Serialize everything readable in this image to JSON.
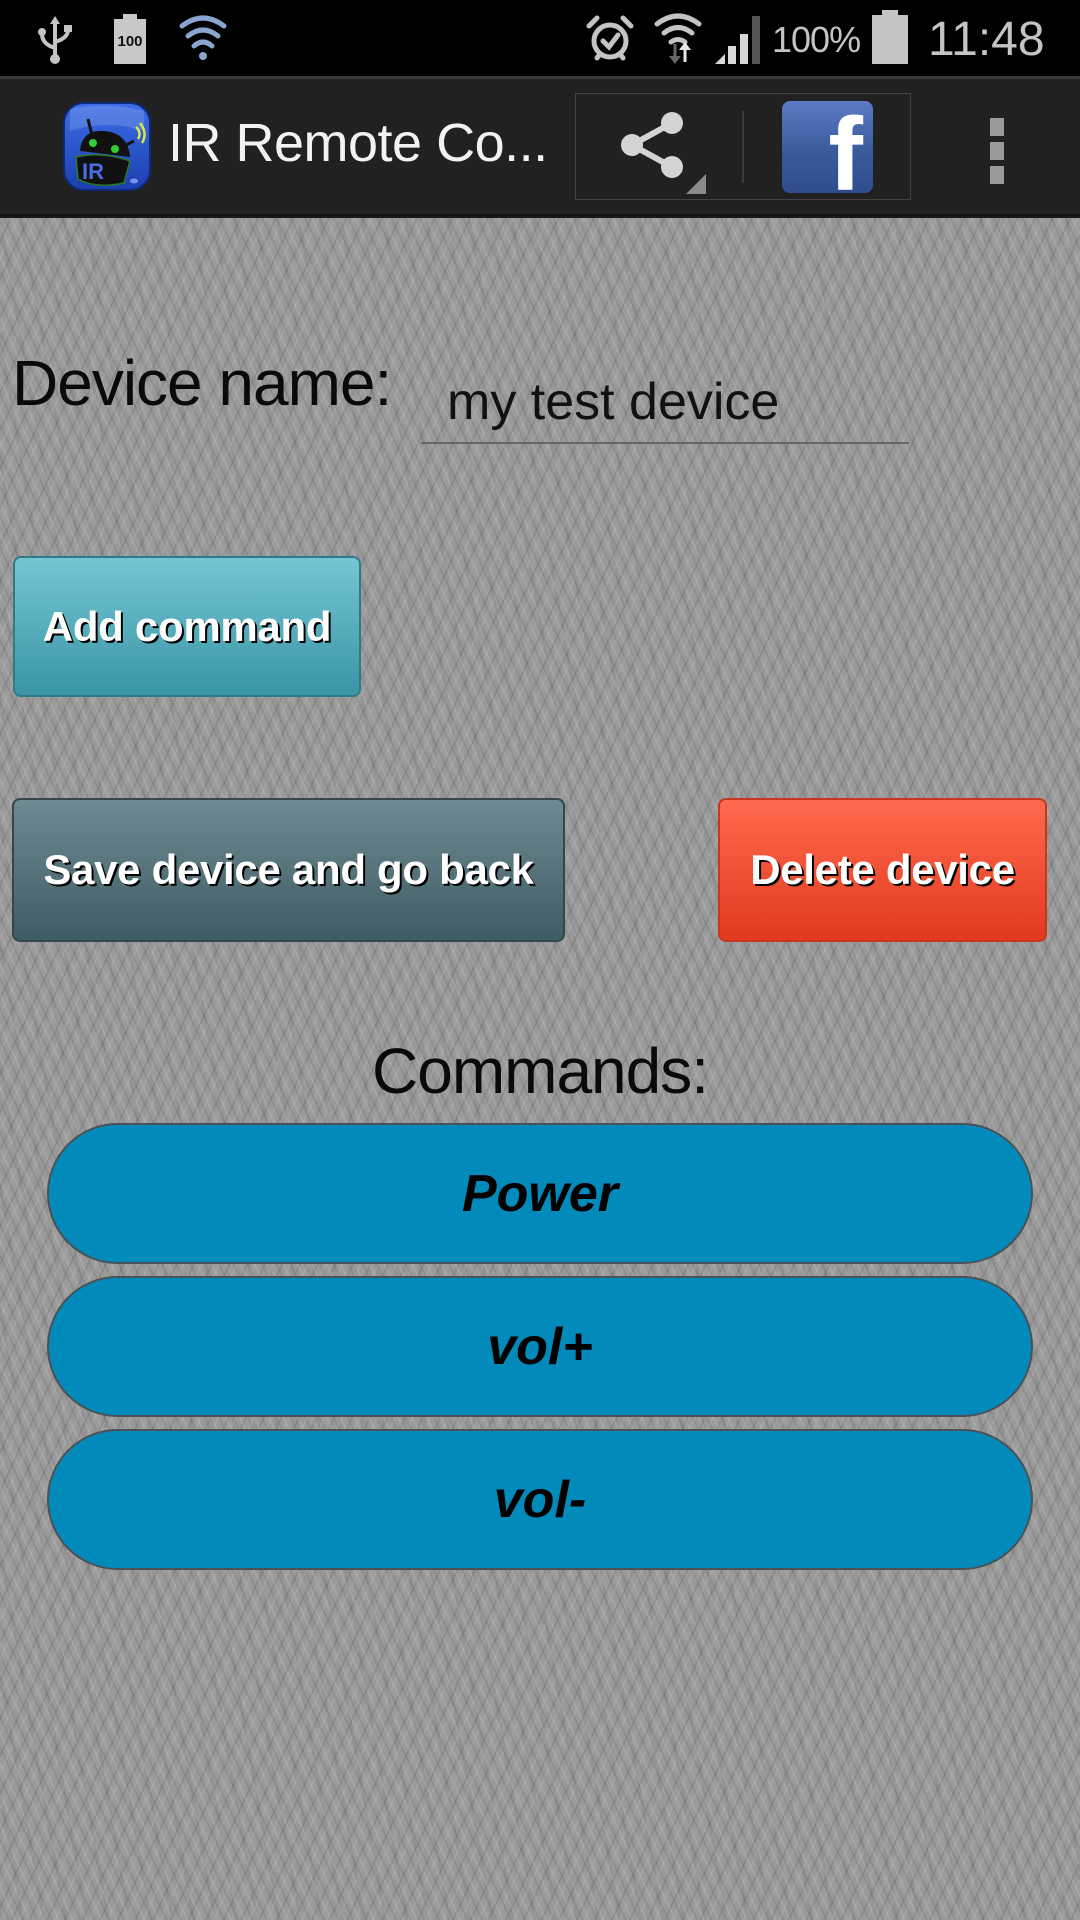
{
  "status_bar": {
    "left_icons": [
      "usb-icon",
      "battery-100-notification-icon",
      "wifi-notification-icon"
    ],
    "battery_notification_label": "100",
    "right_icons": [
      "alarm-icon",
      "wifi-data-icon",
      "signal-icon",
      "battery-icon"
    ],
    "battery_percent": "100%",
    "time": "11:48"
  },
  "action_bar": {
    "app_icon": "ir-remote-app-icon",
    "app_icon_label": "IR",
    "title": "IR Remote Co...",
    "share_icon": "share-icon",
    "facebook_icon_label": "f",
    "overflow_icon": "overflow-menu-icon"
  },
  "form": {
    "device_name_label": "Device name:",
    "device_name_value": "my test device"
  },
  "buttons": {
    "add_command": "Add command",
    "save_device": "Save device and go back",
    "delete_device": "Delete device"
  },
  "commands": {
    "heading": "Commands:",
    "items": [
      "Power",
      "vol+",
      "vol-"
    ]
  },
  "colors": {
    "add_command": "#4fadbd",
    "save_device": "#536f77",
    "delete_device": "#f04e32",
    "command_pill": "#028abb"
  }
}
